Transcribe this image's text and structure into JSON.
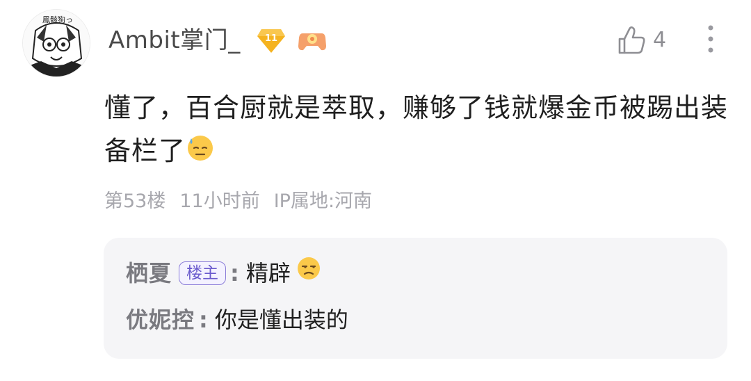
{
  "comment": {
    "username": "Ambit掌门_",
    "level": "11",
    "like_count": "4",
    "text": "懂了，百合厨就是萃取，赚够了钱就爆金币被踢出装备栏了",
    "floor": "第53楼",
    "time": "11小时前",
    "ip": "IP属地:河南",
    "avatar_caption": "鳳骸狗っ"
  },
  "replies": [
    {
      "author": "栖夏",
      "tag": "楼主",
      "text": "精辟",
      "emoji": "unamused-emoji"
    },
    {
      "author": "优妮控",
      "text": "你是懂出装的"
    }
  ],
  "colors": {
    "text_main": "#1f1f1f",
    "text_muted": "#a7a7ad",
    "reply_bg": "#f5f5f7",
    "op_tag": "#6a5acd",
    "level_badge": "#f5b320"
  }
}
